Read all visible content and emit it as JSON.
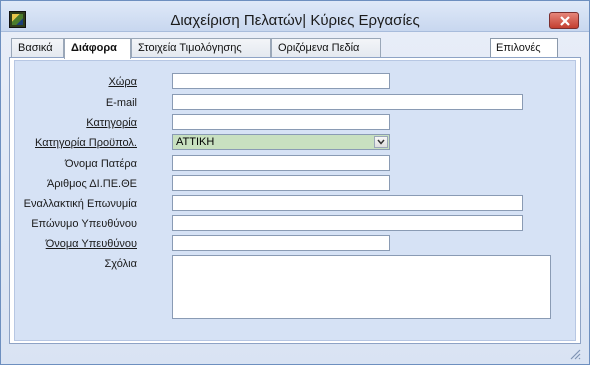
{
  "window": {
    "title": "Διαχείριση Πελατών| Κύριες Εργασίες"
  },
  "tabs": [
    {
      "label": "Βασικά"
    },
    {
      "label": "Διάφορα"
    },
    {
      "label": "Στοιχεία Τιμολόγησης"
    },
    {
      "label": "Οριζόμενα Πεδία"
    }
  ],
  "options_button": "Επιλονές",
  "form": {
    "country": {
      "label": "Χώρα",
      "value": ""
    },
    "email": {
      "label": "E-mail",
      "value": ""
    },
    "category": {
      "label": "Κατηγορία",
      "value": ""
    },
    "budget_category": {
      "label": "Κατηγορία Προϋπολ.",
      "value": "ΑΤΤΙΚΗ"
    },
    "father_name": {
      "label": "Όνομα Πατέρα",
      "value": ""
    },
    "dipethe_number": {
      "label": "Άριθμος ΔΙ.ΠΕ.ΘΕ",
      "value": ""
    },
    "alt_name": {
      "label": "Εναλλακτική Επωνυμία",
      "value": ""
    },
    "manager_surname": {
      "label": "Επώνυμο Υπευθύνου",
      "value": ""
    },
    "manager_name": {
      "label": "Όνομα Υπευθύνου",
      "value": ""
    },
    "comments": {
      "label": "Σχόλια",
      "value": ""
    }
  },
  "colors": {
    "accent": "#c33f31",
    "panel_bg": "#d6e2f5",
    "select_bg": "#c8e0c0"
  },
  "icons": [
    "app-logo-icon",
    "close-icon",
    "chevron-down-icon",
    "resize-grip-icon"
  ]
}
